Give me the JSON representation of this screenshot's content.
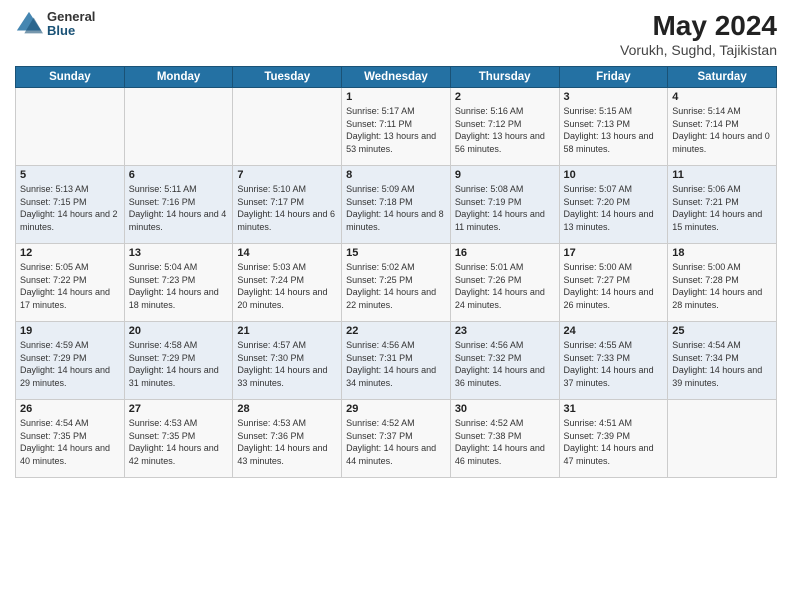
{
  "header": {
    "logo_general": "General",
    "logo_blue": "Blue",
    "month_year": "May 2024",
    "location": "Vorukh, Sughd, Tajikistan"
  },
  "days_of_week": [
    "Sunday",
    "Monday",
    "Tuesday",
    "Wednesday",
    "Thursday",
    "Friday",
    "Saturday"
  ],
  "weeks": [
    [
      {
        "day": "",
        "content": ""
      },
      {
        "day": "",
        "content": ""
      },
      {
        "day": "",
        "content": ""
      },
      {
        "day": "1",
        "content": "Sunrise: 5:17 AM\nSunset: 7:11 PM\nDaylight: 13 hours and 53 minutes."
      },
      {
        "day": "2",
        "content": "Sunrise: 5:16 AM\nSunset: 7:12 PM\nDaylight: 13 hours and 56 minutes."
      },
      {
        "day": "3",
        "content": "Sunrise: 5:15 AM\nSunset: 7:13 PM\nDaylight: 13 hours and 58 minutes."
      },
      {
        "day": "4",
        "content": "Sunrise: 5:14 AM\nSunset: 7:14 PM\nDaylight: 14 hours and 0 minutes."
      }
    ],
    [
      {
        "day": "5",
        "content": "Sunrise: 5:13 AM\nSunset: 7:15 PM\nDaylight: 14 hours and 2 minutes."
      },
      {
        "day": "6",
        "content": "Sunrise: 5:11 AM\nSunset: 7:16 PM\nDaylight: 14 hours and 4 minutes."
      },
      {
        "day": "7",
        "content": "Sunrise: 5:10 AM\nSunset: 7:17 PM\nDaylight: 14 hours and 6 minutes."
      },
      {
        "day": "8",
        "content": "Sunrise: 5:09 AM\nSunset: 7:18 PM\nDaylight: 14 hours and 8 minutes."
      },
      {
        "day": "9",
        "content": "Sunrise: 5:08 AM\nSunset: 7:19 PM\nDaylight: 14 hours and 11 minutes."
      },
      {
        "day": "10",
        "content": "Sunrise: 5:07 AM\nSunset: 7:20 PM\nDaylight: 14 hours and 13 minutes."
      },
      {
        "day": "11",
        "content": "Sunrise: 5:06 AM\nSunset: 7:21 PM\nDaylight: 14 hours and 15 minutes."
      }
    ],
    [
      {
        "day": "12",
        "content": "Sunrise: 5:05 AM\nSunset: 7:22 PM\nDaylight: 14 hours and 17 minutes."
      },
      {
        "day": "13",
        "content": "Sunrise: 5:04 AM\nSunset: 7:23 PM\nDaylight: 14 hours and 18 minutes."
      },
      {
        "day": "14",
        "content": "Sunrise: 5:03 AM\nSunset: 7:24 PM\nDaylight: 14 hours and 20 minutes."
      },
      {
        "day": "15",
        "content": "Sunrise: 5:02 AM\nSunset: 7:25 PM\nDaylight: 14 hours and 22 minutes."
      },
      {
        "day": "16",
        "content": "Sunrise: 5:01 AM\nSunset: 7:26 PM\nDaylight: 14 hours and 24 minutes."
      },
      {
        "day": "17",
        "content": "Sunrise: 5:00 AM\nSunset: 7:27 PM\nDaylight: 14 hours and 26 minutes."
      },
      {
        "day": "18",
        "content": "Sunrise: 5:00 AM\nSunset: 7:28 PM\nDaylight: 14 hours and 28 minutes."
      }
    ],
    [
      {
        "day": "19",
        "content": "Sunrise: 4:59 AM\nSunset: 7:29 PM\nDaylight: 14 hours and 29 minutes."
      },
      {
        "day": "20",
        "content": "Sunrise: 4:58 AM\nSunset: 7:29 PM\nDaylight: 14 hours and 31 minutes."
      },
      {
        "day": "21",
        "content": "Sunrise: 4:57 AM\nSunset: 7:30 PM\nDaylight: 14 hours and 33 minutes."
      },
      {
        "day": "22",
        "content": "Sunrise: 4:56 AM\nSunset: 7:31 PM\nDaylight: 14 hours and 34 minutes."
      },
      {
        "day": "23",
        "content": "Sunrise: 4:56 AM\nSunset: 7:32 PM\nDaylight: 14 hours and 36 minutes."
      },
      {
        "day": "24",
        "content": "Sunrise: 4:55 AM\nSunset: 7:33 PM\nDaylight: 14 hours and 37 minutes."
      },
      {
        "day": "25",
        "content": "Sunrise: 4:54 AM\nSunset: 7:34 PM\nDaylight: 14 hours and 39 minutes."
      }
    ],
    [
      {
        "day": "26",
        "content": "Sunrise: 4:54 AM\nSunset: 7:35 PM\nDaylight: 14 hours and 40 minutes."
      },
      {
        "day": "27",
        "content": "Sunrise: 4:53 AM\nSunset: 7:35 PM\nDaylight: 14 hours and 42 minutes."
      },
      {
        "day": "28",
        "content": "Sunrise: 4:53 AM\nSunset: 7:36 PM\nDaylight: 14 hours and 43 minutes."
      },
      {
        "day": "29",
        "content": "Sunrise: 4:52 AM\nSunset: 7:37 PM\nDaylight: 14 hours and 44 minutes."
      },
      {
        "day": "30",
        "content": "Sunrise: 4:52 AM\nSunset: 7:38 PM\nDaylight: 14 hours and 46 minutes."
      },
      {
        "day": "31",
        "content": "Sunrise: 4:51 AM\nSunset: 7:39 PM\nDaylight: 14 hours and 47 minutes."
      },
      {
        "day": "",
        "content": ""
      }
    ]
  ]
}
